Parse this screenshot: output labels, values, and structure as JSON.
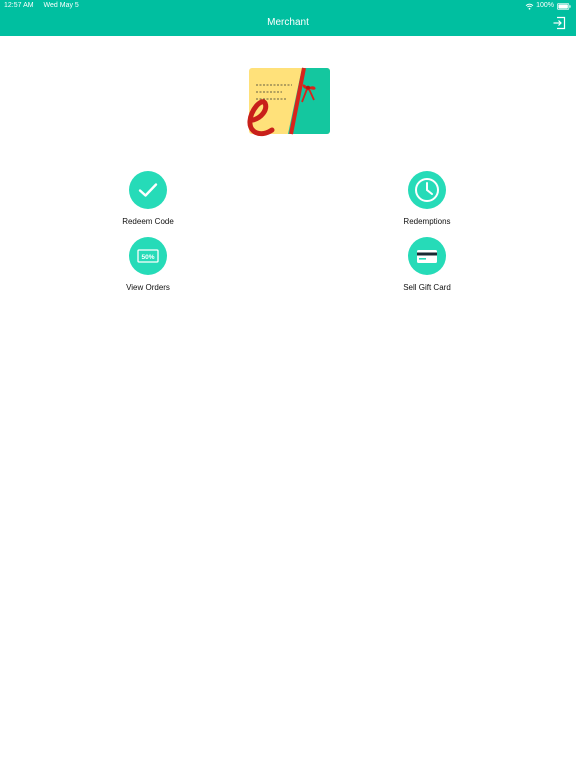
{
  "status_bar": {
    "time": "12:57 AM",
    "date": "Wed May 5",
    "battery": "100%"
  },
  "header": {
    "title": "Merchant",
    "logout_icon": "logout-icon"
  },
  "menu": {
    "redeem": {
      "label": "Redeem Code",
      "icon": "checkmark-icon"
    },
    "redemptions": {
      "label": "Redemptions",
      "icon": "clock-icon"
    },
    "view_orders": {
      "label": "View Orders",
      "icon": "discount-tag-icon",
      "tag_text": "50%"
    },
    "sell_gift_card": {
      "label": "Sell Gift Card",
      "icon": "credit-card-icon"
    }
  },
  "colors": {
    "header": "#00bfa0",
    "icon_circle": "#26dbb8",
    "card_yellow": "#ffe17a",
    "card_green": "#14c79f",
    "accent_red": "#d8241c"
  }
}
